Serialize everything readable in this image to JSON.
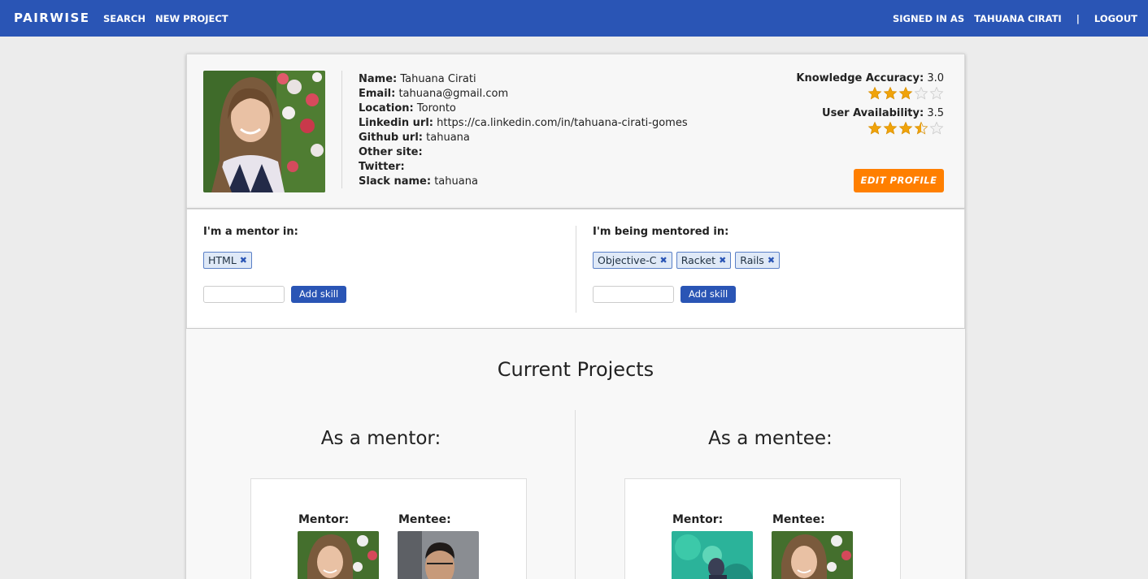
{
  "nav": {
    "brand": "PAIRWISE",
    "search": "SEARCH",
    "new_project": "NEW PROJECT",
    "signed_in_as": "SIGNED IN AS",
    "user_name": "TAHUANA CIRATI",
    "separator": "|",
    "logout": "LOGOUT"
  },
  "profile": {
    "fields": [
      {
        "label": "Name:",
        "value": "Tahuana Cirati"
      },
      {
        "label": "Email:",
        "value": "tahuana@gmail.com"
      },
      {
        "label": "Location:",
        "value": "Toronto"
      },
      {
        "label": "Linkedin url:",
        "value": "https://ca.linkedin.com/in/tahuana-cirati-gomes"
      },
      {
        "label": "Github url:",
        "value": "tahuana"
      },
      {
        "label": "Other site:",
        "value": ""
      },
      {
        "label": "Twitter:",
        "value": ""
      },
      {
        "label": "Slack name:",
        "value": "tahuana"
      }
    ],
    "knowledge": {
      "label": "Knowledge Accuracy:",
      "value": "3.0",
      "rating": 3.0
    },
    "availability": {
      "label": "User Availability:",
      "value": "3.5",
      "rating": 3.5
    },
    "edit_button": "EDIT PROFILE"
  },
  "skills": {
    "mentor": {
      "heading": "I'm a mentor in:",
      "tags": [
        "HTML"
      ],
      "add_button": "Add skill"
    },
    "mentee": {
      "heading": "I'm being mentored in:",
      "tags": [
        "Objective-C",
        "Racket",
        "Rails"
      ],
      "add_button": "Add skill"
    }
  },
  "projects": {
    "title": "Current Projects",
    "as_mentor": {
      "heading": "As a mentor:",
      "mentor_label": "Mentor:",
      "mentee_label": "Mentee:"
    },
    "as_mentee": {
      "heading": "As a mentee:",
      "mentor_label": "Mentor:",
      "mentee_label": "Mentee:"
    }
  },
  "colors": {
    "nav": "#2a55b5",
    "accent": "#ff7f00",
    "star": "#f0a30a"
  }
}
